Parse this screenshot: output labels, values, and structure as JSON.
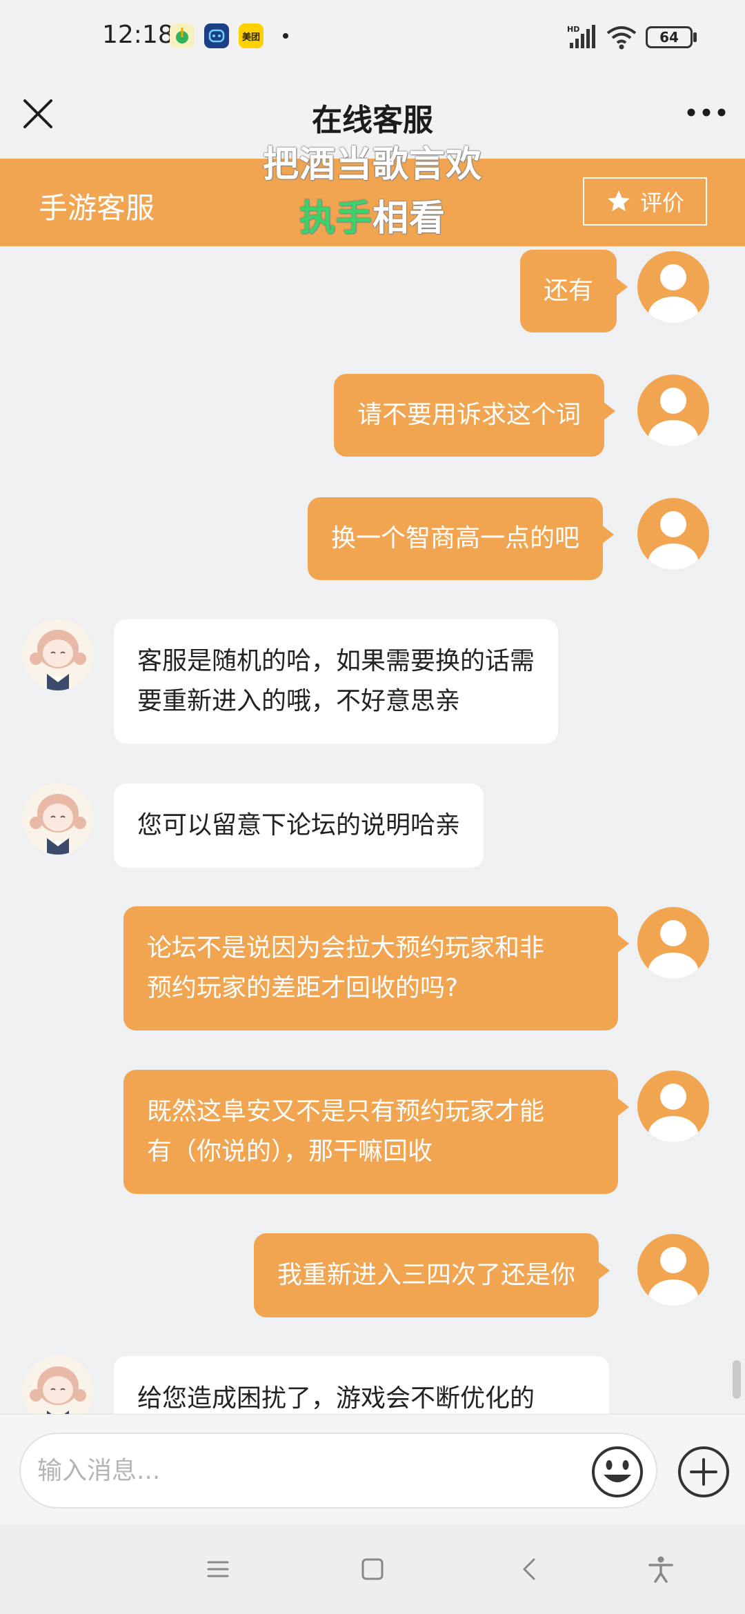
{
  "status_bar": {
    "time": "12:18",
    "apps": [
      {
        "name": "qq-music",
        "label": "♪",
        "bg": "#f7f1c0",
        "fg": "#32b25a"
      },
      {
        "name": "assistant",
        "label": "••",
        "bg": "#1d3f86",
        "fg": "#ffffff"
      },
      {
        "name": "meituan",
        "label": "美团",
        "bg": "#ffd100",
        "fg": "#222222"
      }
    ],
    "network": "HD",
    "battery": "64"
  },
  "title_bar": {
    "title": "在线客服",
    "close_icon": "close-icon",
    "more_icon": "more-icon"
  },
  "sub_header": {
    "title": "手游客服",
    "rate_label": "评价",
    "rate_icon": "star-icon",
    "color": "#f2a550"
  },
  "lyrics": {
    "line1": "把酒当歌言欢",
    "line2_highlight": "执手",
    "line2_rest": "相看",
    "highlight_color": "#3cd46a"
  },
  "messages": [
    {
      "sender": "user",
      "lines": [
        "还有"
      ]
    },
    {
      "sender": "user",
      "lines": [
        "请不要用诉求这个词"
      ]
    },
    {
      "sender": "user",
      "lines": [
        "换一个智商高一点的吧"
      ]
    },
    {
      "sender": "agent",
      "lines": [
        "客服是随机的哈，如果需要换的话需",
        "要重新进入的哦，不好意思亲"
      ]
    },
    {
      "sender": "agent",
      "lines": [
        "您可以留意下论坛的说明哈亲"
      ]
    },
    {
      "sender": "user",
      "lines": [
        "论坛不是说因为会拉大预约玩家和非",
        "预约玩家的差距才回收的吗?"
      ]
    },
    {
      "sender": "user",
      "lines": [
        "既然这阜安又不是只有预约玩家才能",
        "有（你说的），那干嘛回收"
      ]
    },
    {
      "sender": "user",
      "lines": [
        "我重新进入三四次了还是你"
      ]
    },
    {
      "sender": "agent",
      "lines": [
        "给您造成困扰了，游戏会不断优化的"
      ]
    }
  ],
  "input_bar": {
    "placeholder": "输入消息...",
    "emoji_icon": "emoji-icon",
    "plus_icon": "plus-icon"
  },
  "nav_bar": {
    "items": [
      "menu-icon",
      "home-icon",
      "back-icon",
      "accessibility-icon"
    ]
  }
}
